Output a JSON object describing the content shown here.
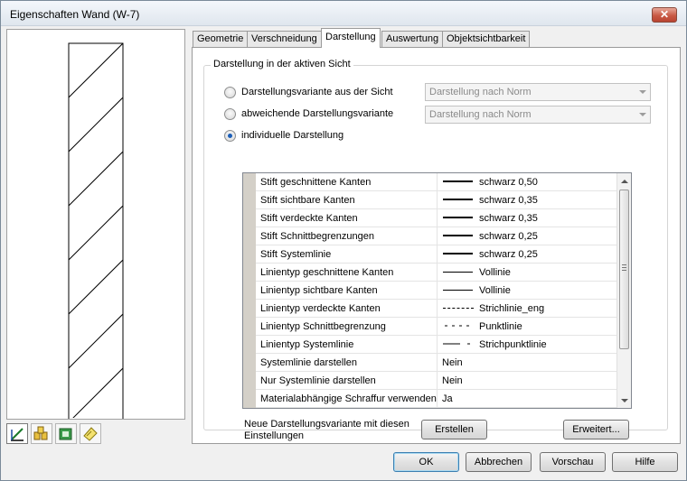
{
  "window": {
    "title": "Eigenschaften Wand (W-7)",
    "close_glyph": "✕"
  },
  "tabs": [
    {
      "label": "Geometrie",
      "active": false
    },
    {
      "label": "Verschneidung",
      "active": false
    },
    {
      "label": "Darstellung",
      "active": true
    },
    {
      "label": "Auswertung",
      "active": false
    },
    {
      "label": "Objektsichtbarkeit",
      "active": false
    }
  ],
  "group": {
    "title": "Darstellung in der aktiven Sicht"
  },
  "radios": [
    {
      "label": "Darstellungsvariante aus der Sicht",
      "checked": false,
      "combo": "Darstellung nach Norm"
    },
    {
      "label": "abweichende Darstellungsvariante",
      "checked": false,
      "combo": "Darstellung nach Norm"
    },
    {
      "label": "individuelle Darstellung",
      "checked": true
    }
  ],
  "properties": [
    {
      "name": "Stift geschnittene Kanten",
      "line": "thick",
      "value": "schwarz 0,50"
    },
    {
      "name": "Stift sichtbare Kanten",
      "line": "thick",
      "value": "schwarz 0,35"
    },
    {
      "name": "Stift verdeckte Kanten",
      "line": "thick",
      "value": "schwarz 0,35"
    },
    {
      "name": "Stift Schnittbegrenzungen",
      "line": "thick",
      "value": "schwarz 0,25"
    },
    {
      "name": "Stift Systemlinie",
      "line": "thick",
      "value": "schwarz 0,25"
    },
    {
      "name": "Linientyp geschnittene Kanten",
      "line": "thin",
      "value": "Vollinie"
    },
    {
      "name": "Linientyp sichtbare Kanten",
      "line": "thin",
      "value": "Vollinie"
    },
    {
      "name": "Linientyp verdeckte Kanten",
      "line": "dotted",
      "value": "Strichlinie_eng"
    },
    {
      "name": "Linientyp Schnittbegrenzung",
      "line": "dot",
      "value": "Punktlinie"
    },
    {
      "name": "Linientyp Systemlinie",
      "line": "dashdot",
      "value": "Strichpunktlinie"
    },
    {
      "name": "Systemlinie darstellen",
      "line": "none",
      "value": "Nein"
    },
    {
      "name": "Nur Systemlinie darstellen",
      "line": "none",
      "value": "Nein"
    },
    {
      "name": "Materialabhängige Schraffur verwenden",
      "line": "none",
      "value": "Ja"
    }
  ],
  "create": {
    "text": "Neue Darstellungsvariante mit diesen Einstellungen",
    "button": "Erstellen"
  },
  "advanced_button": "Erweitert...",
  "footer": {
    "ok": "OK",
    "cancel": "Abbrechen",
    "preview": "Vorschau",
    "help": "Hilfe"
  },
  "tool_icons": [
    "wall-properties-icon",
    "layers-icon",
    "export-icon",
    "note-icon"
  ],
  "colors": {
    "accent": "#1d5fb8",
    "close_button": "#c85a45"
  }
}
